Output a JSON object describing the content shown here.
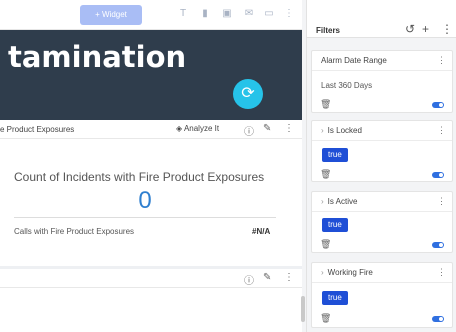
{
  "toolbar": {
    "widget_label": "+ Widget",
    "icons": [
      "text-icon",
      "tag-icon",
      "gif-icon",
      "mail-icon",
      "monitor-icon",
      "more-vert-icon"
    ]
  },
  "banner": {
    "title": "tamination",
    "bg_color": "#2f3d4c",
    "sync_color": "#26c3e9"
  },
  "card": {
    "title": "e Product Exposures",
    "analyze_label": "Analyze It",
    "metric_title": "Count of Incidents with Fire Product Exposures",
    "metric_value": "0",
    "row_label": "Calls with Fire Product Exposures",
    "row_value": "#N/A"
  },
  "filters": {
    "title": "Filters",
    "items": [
      {
        "label": "Alarm Date Range",
        "value": "Last 360 Days"
      },
      {
        "label": "Is Locked",
        "chip": "true"
      },
      {
        "label": "Is Active",
        "chip": "true"
      },
      {
        "label": "Working Fire",
        "chip": "true"
      }
    ]
  }
}
